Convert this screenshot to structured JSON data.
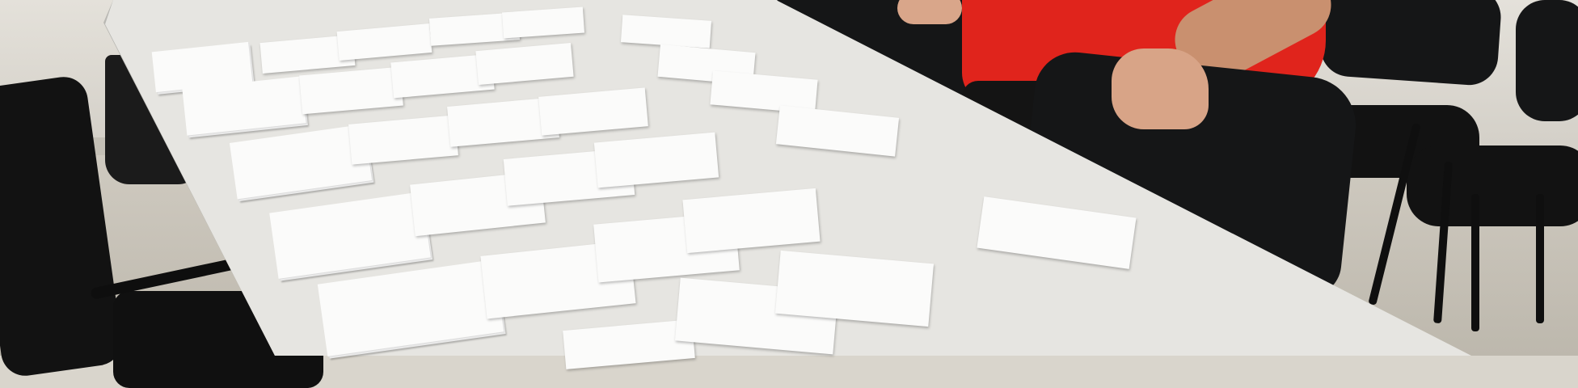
{
  "scene": {
    "description_icons": [
      "table",
      "index-card",
      "chair",
      "waste-bin"
    ]
  },
  "cards": [
    {
      "id": "c1",
      "text": ""
    },
    {
      "id": "c2",
      "text": ""
    },
    {
      "id": "c3",
      "text": ""
    },
    {
      "id": "c4",
      "text": ""
    },
    {
      "id": "c5",
      "text": ""
    },
    {
      "id": "c6",
      "text": ""
    },
    {
      "id": "c7",
      "text": ""
    },
    {
      "id": "c8",
      "text": ""
    },
    {
      "id": "c9",
      "text": ""
    },
    {
      "id": "c10",
      "text": ""
    },
    {
      "id": "c11",
      "text": ""
    },
    {
      "id": "c12",
      "text": ""
    },
    {
      "id": "c13",
      "text": ""
    },
    {
      "id": "c14",
      "text": ""
    },
    {
      "id": "c15",
      "text": ""
    },
    {
      "id": "c16",
      "text": ""
    },
    {
      "id": "c17",
      "text": ""
    },
    {
      "id": "c18",
      "text": ""
    },
    {
      "id": "c19",
      "text": ""
    },
    {
      "id": "c20",
      "text": ""
    },
    {
      "id": "c21",
      "text": ""
    },
    {
      "id": "c22",
      "text": ""
    },
    {
      "id": "c23",
      "text": ""
    },
    {
      "id": "c24",
      "text": ""
    },
    {
      "id": "c25",
      "text": ""
    }
  ],
  "colors": {
    "shirt": "#e0241c",
    "table": "#e6e5e1",
    "card": "#fbfbfa",
    "chair": "#151617"
  }
}
